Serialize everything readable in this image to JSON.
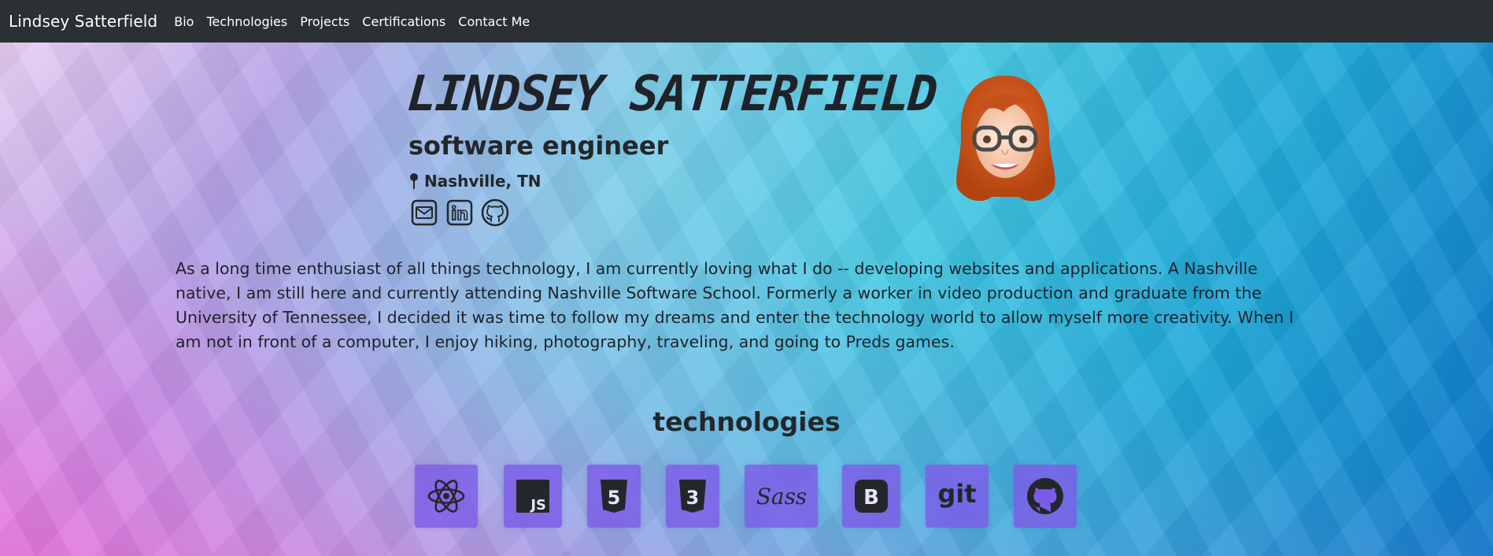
{
  "navbar": {
    "brand": "Lindsey Satterfield",
    "links": [
      "Bio",
      "Technologies",
      "Projects",
      "Certifications",
      "Contact Me"
    ]
  },
  "hero": {
    "name": "LINDSEY SATTERFIELD",
    "role": "software engineer",
    "location": "Nashville, TN",
    "socials": [
      "mail-icon",
      "linkedin-icon",
      "github-icon"
    ],
    "avatar": "memoji-avatar"
  },
  "bio": {
    "text": "As a long time enthusiast of all things technology, I am currently loving what I do -- developing websites and applications. A Nashville native, I am still here and currently attending Nashville Software School. Formerly a worker in video production and graduate from the University of Tennessee, I decided it was time to follow my dreams and enter the technology world to allow myself more creativity. When I am not in front of a computer, I enjoy hiking, photography, traveling, and going to Preds games."
  },
  "technologies": {
    "title": "technologies",
    "items": [
      "react-icon",
      "javascript-icon",
      "html5-icon",
      "css3-icon",
      "sass-icon",
      "bootstrap-icon",
      "git-icon",
      "github-icon"
    ],
    "labels": {
      "js": "JS",
      "html": "5",
      "css": "3",
      "sass": "Sass",
      "bootstrap": "B",
      "git": "git"
    }
  },
  "colors": {
    "navbar": "#2b3035",
    "tile": "#7c5ce6",
    "text": "#23272b"
  }
}
